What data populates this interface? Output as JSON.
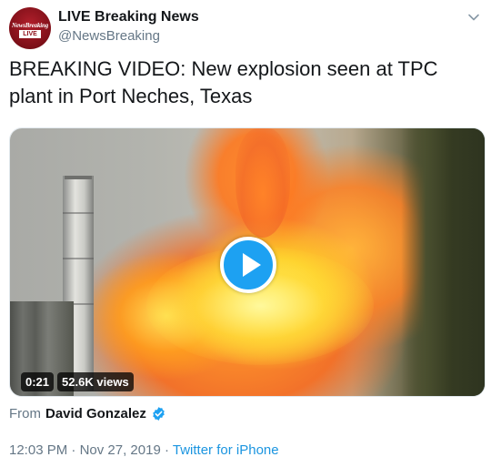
{
  "account": {
    "name": "LIVE Breaking News",
    "handle": "@NewsBreaking",
    "avatar_logo_top": "NewsBreaking",
    "avatar_logo_bottom": "LIVE"
  },
  "tweet": {
    "text": "BREAKING VIDEO: New explosion seen at TPC plant in Port Neches, Texas"
  },
  "media": {
    "duration": "0:21",
    "views": "52.6K views"
  },
  "source": {
    "prefix": "From",
    "author": "David Gonzalez"
  },
  "meta": {
    "time": "12:03 PM",
    "sep1": "·",
    "date": "Nov 27, 2019",
    "sep2": "·",
    "app": "Twitter for iPhone"
  },
  "icons": {
    "menu": "chevron-down-icon",
    "play": "play-icon",
    "verified": "verified-badge-icon"
  },
  "colors": {
    "accent": "#1da1f2",
    "link": "#1b95e0",
    "secondary_text": "#657786",
    "avatar_red": "#8d0f19"
  }
}
